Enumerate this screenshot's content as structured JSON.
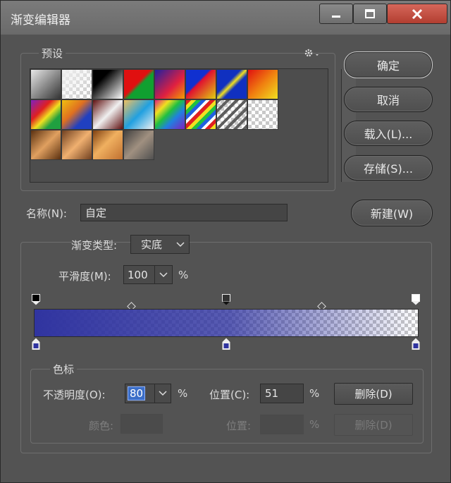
{
  "window": {
    "title": "渐变编辑器"
  },
  "presets": {
    "label": "预设"
  },
  "buttons": {
    "ok": "确定",
    "cancel": "取消",
    "load": "载入(L)...",
    "save": "存储(S)...",
    "new": "新建(W)"
  },
  "name": {
    "label": "名称(N):",
    "value": "自定"
  },
  "gradient": {
    "type_label": "渐变类型:",
    "type_value": "实底",
    "smooth_label": "平滑度(M):",
    "smooth_value": "100",
    "smooth_unit": "%",
    "color_start": "#3034a0",
    "opacity_stops": [
      1.0,
      0.8,
      0.0
    ],
    "opacity_stop_positions_pct": [
      0,
      51,
      100
    ]
  },
  "stops": {
    "label": "色标",
    "opacity_label": "不透明度(O):",
    "opacity_value": "80",
    "opacity_unit": "%",
    "pos_label": "位置(C):",
    "pos_value": "51",
    "pos_unit": "%",
    "delete": "删除(D)",
    "color_label": "颜色:",
    "pos2_label": "位置:",
    "pos2_unit": "%",
    "delete2": "删除(D)"
  }
}
